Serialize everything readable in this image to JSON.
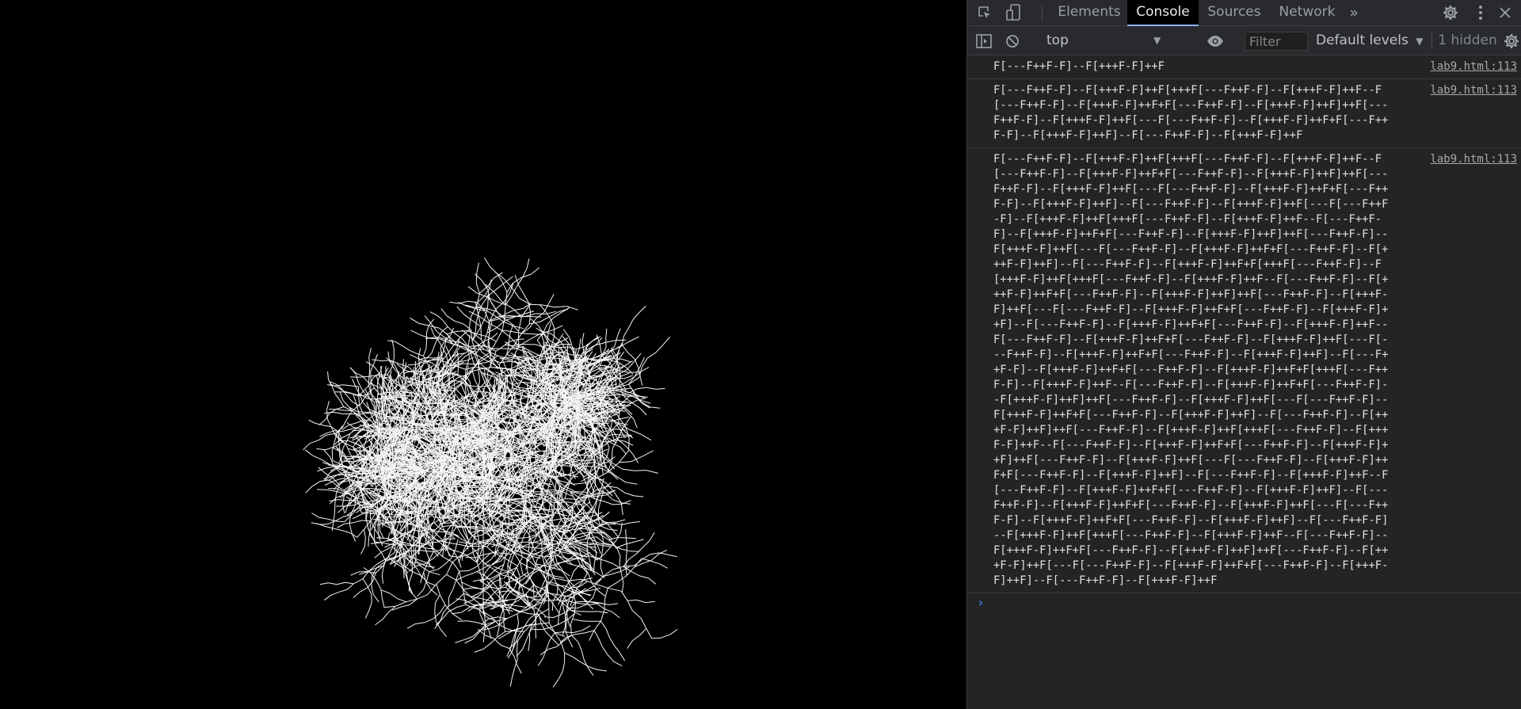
{
  "canvas": {
    "stroke_color": "#f5f5f5",
    "background": "#000000"
  },
  "devtools": {
    "tabs": [
      {
        "label": "Elements",
        "active": false
      },
      {
        "label": "Console",
        "active": true
      },
      {
        "label": "Sources",
        "active": false
      },
      {
        "label": "Network",
        "active": false
      }
    ],
    "icons": {
      "inspect": "inspect-element-icon",
      "device": "device-toolbar-icon",
      "more_tabs": "double-chevron-right-icon",
      "settings": "gear-icon",
      "menu": "kebab-menu-icon",
      "close": "close-icon"
    },
    "toolbar": {
      "context": "top",
      "filter_placeholder": "Filter",
      "levels": "Default levels",
      "hidden": "1 hidden"
    },
    "console": {
      "messages": [
        {
          "text": "F[---F++F-F]--F[+++F-F]++F",
          "source": "lab9.html:113"
        },
        {
          "text": "F[---F++F-F]--F[+++F-F]++F[+++F[---F++F-F]--F[+++F-F]++F--F[---F++F-F]--F[+++F-F]++F+F[---F++F-F]--F[+++F-F]++F]++F[---F++F-F]--F[+++F-F]++F[---F[---F++F-F]--F[+++F-F]++F+F[---F++F-F]--F[+++F-F]++F]--F[---F++F-F]--F[+++F-F]++F",
          "source": "lab9.html:113"
        },
        {
          "text": "F[---F++F-F]--F[+++F-F]++F[+++F[---F++F-F]--F[+++F-F]++F--F[---F++F-F]--F[+++F-F]++F+F[---F++F-F]--F[+++F-F]++F]++F[---F++F-F]--F[+++F-F]++F[---F[---F++F-F]--F[+++F-F]++F+F[---F++F-F]--F[+++F-F]++F]--F[---F++F-F]--F[+++F-F]++F[---F[---F++F-F]--F[+++F-F]++F[+++F[---F++F-F]--F[+++F-F]++F--F[---F++F-F]--F[+++F-F]++F+F[---F++F-F]--F[+++F-F]++F]++F[---F++F-F]--F[+++F-F]++F[---F[---F++F-F]--F[+++F-F]++F+F[---F++F-F]--F[+++F-F]++F]--F[---F++F-F]--F[+++F-F]++F+F[+++F[---F++F-F]--F[+++F-F]++F[+++F[---F++F-F]--F[+++F-F]++F--F[---F++F-F]--F[+++F-F]++F+F[---F++F-F]--F[+++F-F]++F]++F[---F++F-F]--F[+++F-F]++F[---F[---F++F-F]--F[+++F-F]++F+F[---F++F-F]--F[+++F-F]++F]--F[---F++F-F]--F[+++F-F]++F+F[---F++F-F]--F[+++F-F]++F--F[---F++F-F]--F[+++F-F]++F+F[---F++F-F]--F[+++F-F]++F[---F[---F++F-F]--F[+++F-F]++F+F[---F++F-F]--F[+++F-F]++F]--F[---F++F-F]--F[+++F-F]++F+F[---F++F-F]--F[+++F-F]++F+F[+++F[---F++F-F]--F[+++F-F]++F--F[---F++F-F]--F[+++F-F]++F+F[---F++F-F]--F[+++F-F]++F]++F[---F++F-F]--F[+++F-F]++F[---F[---F++F-F]--F[+++F-F]++F+F[---F++F-F]--F[+++F-F]++F]--F[---F++F-F]--F[+++F-F]++F]++F[---F++F-F]--F[+++F-F]++F[+++F[---F++F-F]--F[+++F-F]++F--F[---F++F-F]--F[+++F-F]++F+F[---F++F-F]--F[+++F-F]++F]++F[---F++F-F]--F[+++F-F]++F[---F[---F++F-F]--F[+++F-F]++F+F[---F++F-F]--F[+++F-F]++F]--F[---F++F-F]--F[+++F-F]++F--F[---F++F-F]--F[+++F-F]++F+F[---F++F-F]--F[+++F-F]++F]--F[---F++F-F]--F[+++F-F]++F+F[---F++F-F]--F[+++F-F]++F[---F[---F++F-F]--F[+++F-F]++F+F[---F++F-F]--F[+++F-F]++F]--F[---F++F-F]--F[+++F-F]++F[+++F[---F++F-F]--F[+++F-F]++F--F[---F++F-F]--F[+++F-F]++F+F[---F++F-F]--F[+++F-F]++F]++F[---F++F-F]--F[+++F-F]++F[---F[---F++F-F]--F[+++F-F]++F+F[---F++F-F]--F[+++F-F]++F]--F[---F++F-F]--F[+++F-F]++F",
          "source": "lab9.html:113"
        }
      ],
      "prompt_symbol": "›"
    }
  }
}
